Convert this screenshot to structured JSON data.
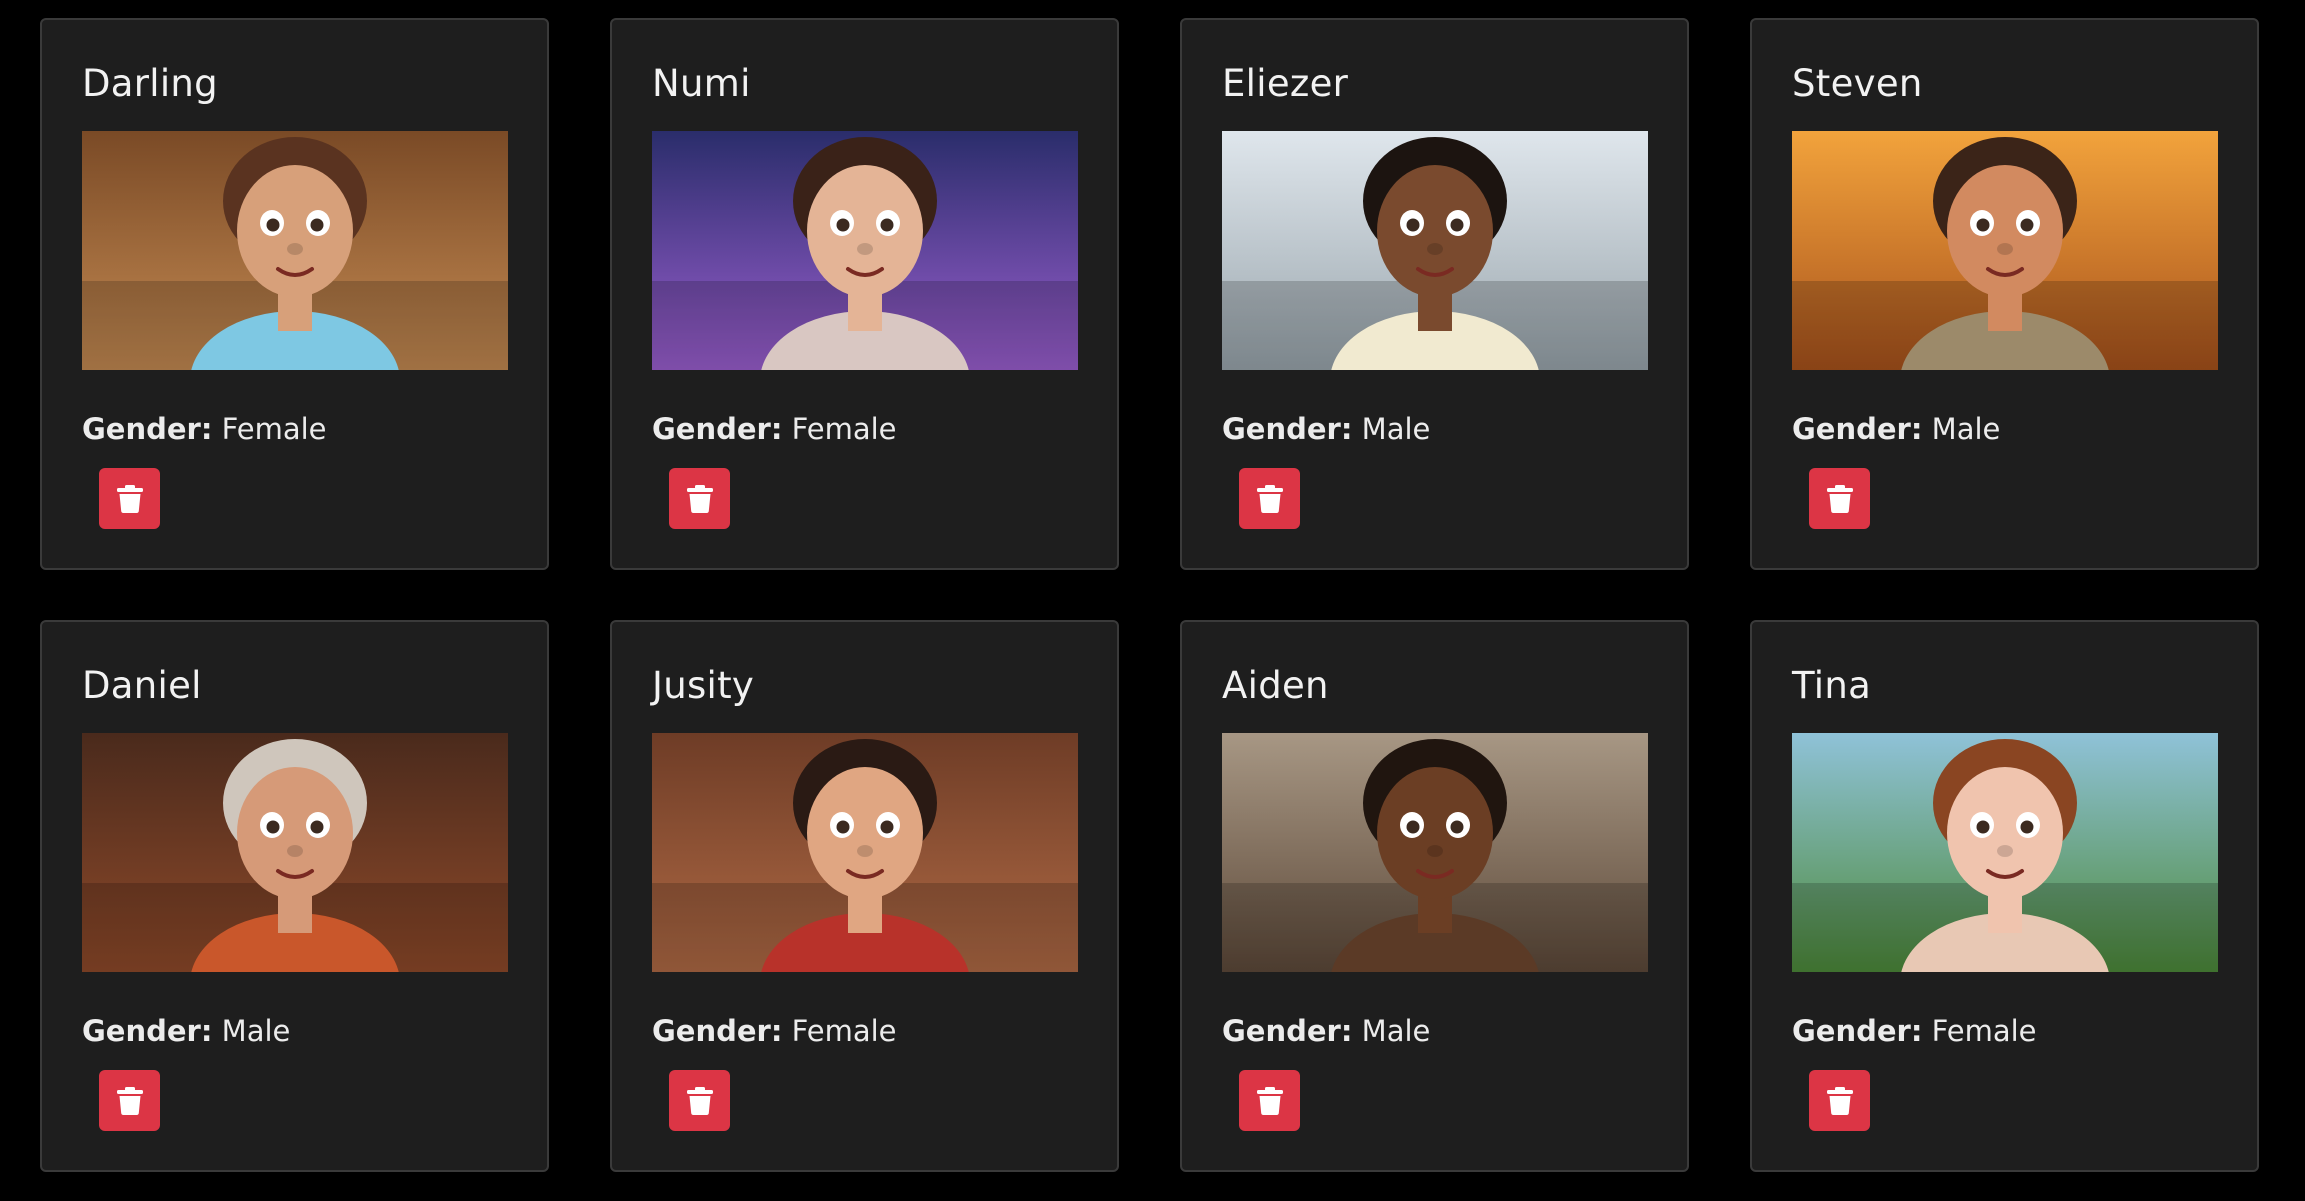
{
  "gender_label": "Gender:",
  "characters": [
    {
      "name": "Darling",
      "gender": "Female",
      "skin": "#d7a07a",
      "hair": "#5a3320",
      "shirt": "#7ec8e3",
      "bg_top": "#7a4a26",
      "bg_bottom": "#c48a52"
    },
    {
      "name": "Numi",
      "gender": "Female",
      "skin": "#e4b496",
      "hair": "#3a2218",
      "shirt": "#d9c7c2",
      "bg_top": "#2a2d6b",
      "bg_bottom": "#9b5fd0"
    },
    {
      "name": "Eliezer",
      "gender": "Male",
      "skin": "#7a4a2e",
      "hair": "#1c1410",
      "shirt": "#f1ead0",
      "bg_top": "#dfe6ec",
      "bg_bottom": "#9aa6ad"
    },
    {
      "name": "Steven",
      "gender": "Male",
      "skin": "#d28a60",
      "hair": "#3b2418",
      "shirt": "#9c8a6a",
      "bg_top": "#f2a33c",
      "bg_bottom": "#a8521c"
    },
    {
      "name": "Daniel",
      "gender": "Male",
      "skin": "#d69a78",
      "hair": "#cfc6bc",
      "shirt": "#c9572b",
      "bg_top": "#4a2a1c",
      "bg_bottom": "#8f4a2a"
    },
    {
      "name": "Jusity",
      "gender": "Female",
      "skin": "#e0a682",
      "hair": "#2a1a14",
      "shirt": "#b8322a",
      "bg_top": "#6e3c26",
      "bg_bottom": "#b06a45"
    },
    {
      "name": "Aiden",
      "gender": "Male",
      "skin": "#6b3e24",
      "hair": "#20150f",
      "shirt": "#5b3a26",
      "bg_top": "#a79784",
      "bg_bottom": "#5e4a3a"
    },
    {
      "name": "Tina",
      "gender": "Female",
      "skin": "#f0c4ae",
      "hair": "#8a4522",
      "shirt": "#e8c8b4",
      "bg_top": "#8fc2d8",
      "bg_bottom": "#4d8a3a"
    }
  ]
}
